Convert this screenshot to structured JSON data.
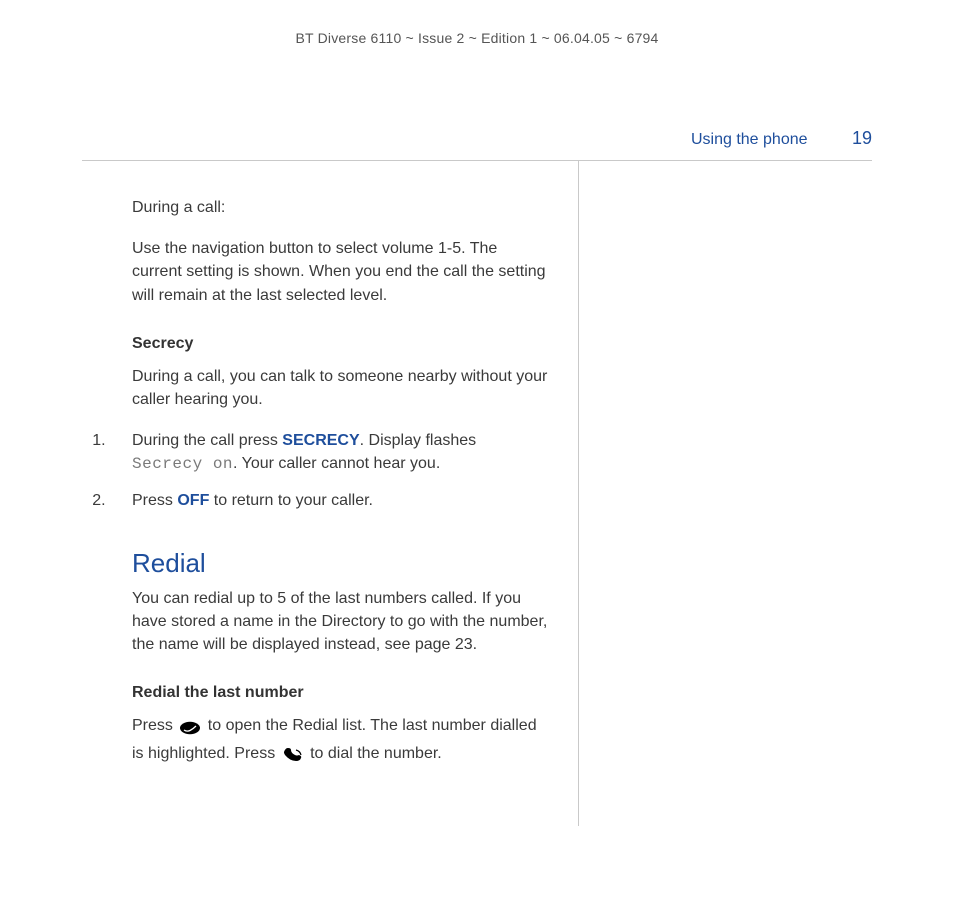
{
  "header": {
    "doc_id": "BT Diverse 6110 ~ Issue 2 ~ Edition 1 ~ 06.04.05 ~ 6794"
  },
  "running_head": {
    "section": "Using the phone",
    "page": "19"
  },
  "during_call": {
    "lead": "During a call:",
    "volume_text": "Use the navigation button to select volume 1-5. The current setting is shown. When you end the call the setting will remain at the last selected level."
  },
  "secrecy": {
    "heading": "Secrecy",
    "intro": "During a call, you can talk to someone nearby without your caller hearing you.",
    "steps": {
      "s1_pre": "During the call press ",
      "s1_kw": "SECRECY",
      "s1_mid": ". Display flashes ",
      "s1_lcd": "Secrecy on",
      "s1_post": ". Your caller cannot hear you.",
      "s2_pre": "Press ",
      "s2_kw": "OFF",
      "s2_post": " to return to your caller."
    }
  },
  "redial": {
    "title": "Redial",
    "intro": "You can redial up to 5 of the last numbers called. If you have stored a name in the Directory to go with the number, the name will be displayed instead, see page 23.",
    "last_number_heading": "Redial the last number",
    "last_number": {
      "pre": "Press ",
      "mid": " to open the Redial list. The last number dialled is highlighted. Press ",
      "post": " to dial the number."
    }
  }
}
